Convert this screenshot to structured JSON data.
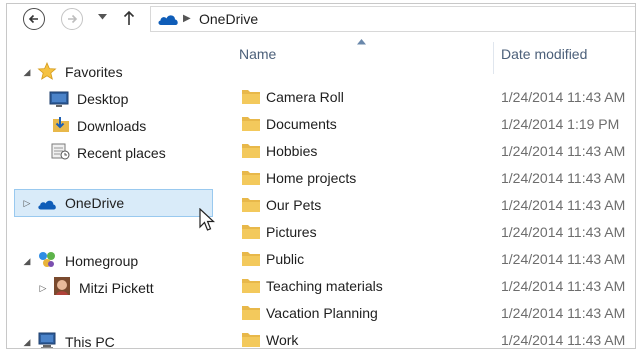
{
  "address": {
    "path": "OneDrive"
  },
  "nav_pane": {
    "favorites": {
      "label": "Favorites",
      "items": [
        "Desktop",
        "Downloads",
        "Recent places"
      ]
    },
    "onedrive": {
      "label": "OneDrive",
      "selected": true
    },
    "homegroup": {
      "label": "Homegroup",
      "items": [
        "Mitzi Pickett"
      ]
    },
    "this_pc": {
      "label": "This PC"
    }
  },
  "file_list": {
    "columns": {
      "name": "Name",
      "date_modified": "Date modified"
    },
    "rows": [
      {
        "name": "Camera Roll",
        "date": "1/24/2014 11:43 AM"
      },
      {
        "name": "Documents",
        "date": "1/24/2014 1:19 PM"
      },
      {
        "name": "Hobbies",
        "date": "1/24/2014 11:43 AM"
      },
      {
        "name": "Home projects",
        "date": "1/24/2014 11:43 AM"
      },
      {
        "name": "Our Pets",
        "date": "1/24/2014 11:43 AM"
      },
      {
        "name": "Pictures",
        "date": "1/24/2014 11:43 AM"
      },
      {
        "name": "Public",
        "date": "1/24/2014 11:43 AM"
      },
      {
        "name": "Teaching materials",
        "date": "1/24/2014 11:43 AM"
      },
      {
        "name": "Vacation Planning",
        "date": "1/24/2014 11:43 AM"
      },
      {
        "name": "Work",
        "date": "1/24/2014 11:43 AM"
      }
    ]
  },
  "colors": {
    "selection": "#d9ebf9",
    "selection_border": "#99c9ef",
    "folder": "#e8b84a",
    "onedrive": "#0f5db8",
    "header_text": "#4c607a"
  }
}
